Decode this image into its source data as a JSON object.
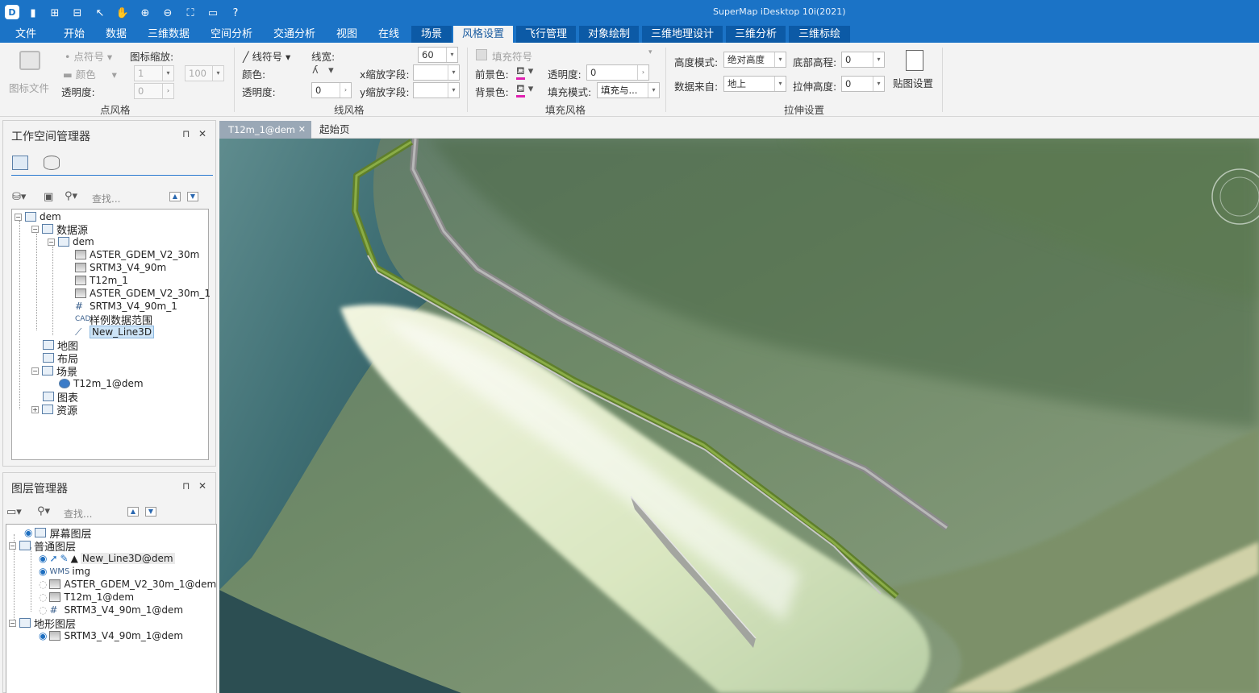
{
  "app": {
    "title": "SuperMap iDesktop 10i(2021)",
    "logo": "D"
  },
  "quick_access": [
    "save-icon",
    "import-icon",
    "export-icon",
    "select-arrow-icon",
    "pan-hand-icon",
    "zoom-in-icon",
    "zoom-out-icon",
    "full-extent-icon",
    "open-folder-icon",
    "help-icon"
  ],
  "menu": {
    "tabs": [
      {
        "label": "文件"
      },
      {
        "label": "开始"
      },
      {
        "label": "数据"
      },
      {
        "label": "三维数据"
      },
      {
        "label": "空间分析"
      },
      {
        "label": "交通分析"
      },
      {
        "label": "视图"
      },
      {
        "label": "在线"
      },
      {
        "label": "场景"
      },
      {
        "label": "风格设置"
      },
      {
        "label": "飞行管理"
      },
      {
        "label": "对象绘制"
      },
      {
        "label": "三维地理设计"
      },
      {
        "label": "三维分析"
      },
      {
        "label": "三维标绘"
      }
    ],
    "active": "风格设置"
  },
  "ribbon": {
    "point_style": {
      "icon_file": "图标文件",
      "point_symbol": "点符号",
      "color": "颜色",
      "icon_scale": "图标缩放:",
      "scale_value": "1",
      "scale_max": "100",
      "transparency": "透明度:",
      "transparency_value": "0",
      "group": "点风格"
    },
    "line_style": {
      "line_symbol": "线符号",
      "line_width": "线宽:",
      "line_width_value": "60",
      "color": "颜色:",
      "transparency": "透明度:",
      "transparency_value": "0",
      "x_scale_field": "x缩放字段:",
      "y_scale_field": "y缩放字段:",
      "group": "线风格"
    },
    "fill_style": {
      "fill_symbol": "填充符号",
      "fg_color": "前景色:",
      "bg_color": "背景色:",
      "transparency": "透明度:",
      "transparency_value": "0",
      "fill_mode": "填充模式:",
      "fill_mode_value": "填充与...",
      "group": "填充风格"
    },
    "extrude": {
      "height_mode": "高度模式:",
      "height_mode_value": "绝对高度",
      "base_height": "底部高程:",
      "base_height_value": "0",
      "data_source": "数据来自:",
      "data_source_value": "地上",
      "extrude_height": "拉伸高度:",
      "extrude_height_value": "0",
      "texture": "贴图设置",
      "group": "拉伸设置"
    }
  },
  "workspace": {
    "title": "工作空间管理器",
    "search_placeholder": "查找...",
    "tree": {
      "root": "dem",
      "datasources": "数据源",
      "datasource": "dem",
      "datasets": [
        "ASTER_GDEM_V2_30m",
        "SRTM3_V4_90m",
        "T12m_1",
        "ASTER_GDEM_V2_30m_1",
        "SRTM3_V4_90m_1",
        "样例数据范围",
        "New_Line3D"
      ],
      "maps": "地图",
      "layouts": "布局",
      "scenes": "场景",
      "scene_item": "T12m_1@dem",
      "charts": "图表",
      "resources": "资源"
    }
  },
  "layers": {
    "title": "图层管理器",
    "search_placeholder": "查找...",
    "screen_layers": "屏幕图层",
    "normal_layers": "普通图层",
    "normal_items": [
      "New_Line3D@dem",
      "img",
      "ASTER_GDEM_V2_30m_1@dem",
      "T12m_1@dem",
      "SRTM3_V4_90m_1@dem"
    ],
    "terrain_layers": "地形图层",
    "terrain_items": [
      "SRTM3_V4_90m_1@dem"
    ]
  },
  "doc_tabs": {
    "scene_tab": "T12m_1@dem",
    "start_tab": "起始页",
    "close": "✕"
  },
  "icons": {
    "pin": "⊓",
    "close": "✕"
  },
  "colors": {
    "title_bar": "#1b73c6",
    "tab_active_text": "#1b5ca0",
    "road_green": "#6f8f34",
    "road_grey": "#9c9c9c"
  }
}
